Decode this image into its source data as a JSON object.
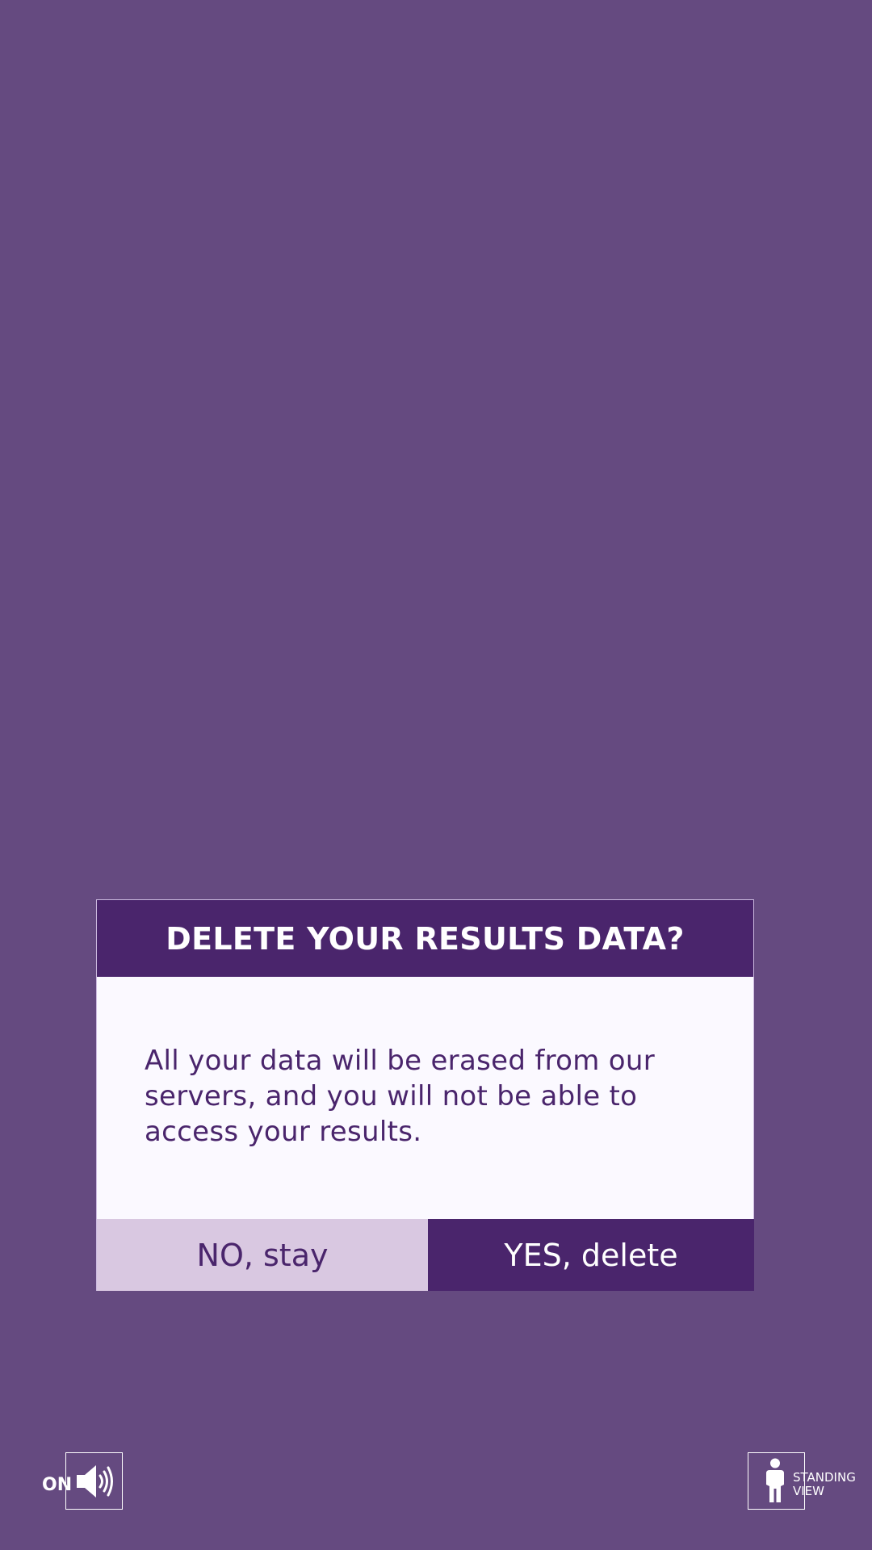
{
  "dialog": {
    "title": "DELETE YOUR RESULTS DATA?",
    "message": "All your data will be erased from our servers, and you will not be able to access your results.",
    "no_button": "NO, stay",
    "yes_button": "YES, delete"
  },
  "sound_toggle": {
    "state_label": "ON",
    "icon": "speaker-icon"
  },
  "view_toggle": {
    "label": "STANDING\nVIEW",
    "icon": "person-standing-icon"
  },
  "colors": {
    "background": "#654a80",
    "dialog_header": "#4a256c",
    "dialog_body": "#fbf9ff",
    "no_button": "#d9c8e1",
    "yes_button": "#4a256c"
  }
}
